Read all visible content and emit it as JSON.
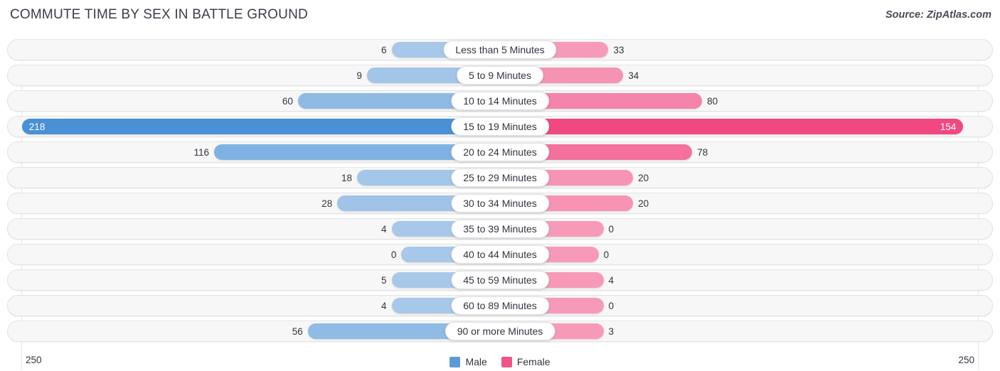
{
  "header": {
    "title": "COMMUTE TIME BY SEX IN BATTLE GROUND",
    "source": "Source: ZipAtlas.com"
  },
  "axis": {
    "left_label": "250",
    "right_label": "250"
  },
  "legend": {
    "items": [
      {
        "label": "Male",
        "color": "#5b9bd5"
      },
      {
        "label": "Female",
        "color": "#f0548b"
      }
    ]
  },
  "chart_data": {
    "type": "bar",
    "title": "COMMUTE TIME BY SEX IN BATTLE GROUND",
    "subtitle": "Source: ZipAtlas.com",
    "orientation": "horizontal-diverging",
    "xlabel": "",
    "ylabel": "",
    "xlim": [
      250,
      250
    ],
    "grid": false,
    "legend_position": "bottom-center",
    "categories": [
      "Less than 5 Minutes",
      "5 to 9 Minutes",
      "10 to 14 Minutes",
      "15 to 19 Minutes",
      "20 to 24 Minutes",
      "25 to 29 Minutes",
      "30 to 34 Minutes",
      "35 to 39 Minutes",
      "40 to 44 Minutes",
      "45 to 59 Minutes",
      "60 to 89 Minutes",
      "90 or more Minutes"
    ],
    "series": [
      {
        "name": "Male",
        "color": "#5b9bd5",
        "values": [
          6,
          9,
          60,
          218,
          116,
          18,
          28,
          4,
          0,
          5,
          4,
          56
        ]
      },
      {
        "name": "Female",
        "color": "#f0548b",
        "values": [
          33,
          34,
          80,
          154,
          78,
          20,
          20,
          0,
          0,
          4,
          0,
          3
        ]
      }
    ]
  },
  "rows": [
    {
      "label": "Less than 5 Minutes",
      "male": "6",
      "female": "33",
      "male_w": 22,
      "female_w": 22,
      "male_color": "#a8c8ea",
      "female_color": "#f79ab8",
      "male_inside": false,
      "female_inside": false
    },
    {
      "label": "5 to 9 Minutes",
      "male": "9",
      "female": "34",
      "male_w": 27,
      "female_w": 25,
      "male_color": "#a3c5e8",
      "female_color": "#f593b3",
      "male_inside": false,
      "female_inside": false
    },
    {
      "label": "10 to 14 Minutes",
      "male": "60",
      "female": "80",
      "male_w": 41,
      "female_w": 41,
      "male_color": "#8ebae4",
      "female_color": "#f583ab",
      "male_inside": false,
      "female_inside": false
    },
    {
      "label": "15 to 19 Minutes",
      "male": "218",
      "female": "154",
      "male_w": 97,
      "female_w": 94,
      "male_color": "#4a90d5",
      "female_color": "#f04880",
      "male_inside": true,
      "female_inside": true
    },
    {
      "label": "20 to 24 Minutes",
      "male": "116",
      "female": "78",
      "male_w": 58,
      "female_w": 39,
      "male_color": "#7fb2e2",
      "female_color": "#f4719e",
      "male_inside": false,
      "female_inside": false
    },
    {
      "label": "25 to 29 Minutes",
      "male": "18",
      "female": "20",
      "male_w": 29,
      "female_w": 27,
      "male_color": "#a4c6e9",
      "female_color": "#f794b4",
      "male_inside": false,
      "female_inside": false
    },
    {
      "label": "30 to 34 Minutes",
      "male": "28",
      "female": "20",
      "male_w": 33,
      "female_w": 27,
      "male_color": "#a0c3e7",
      "female_color": "#f794b4",
      "male_inside": false,
      "female_inside": false
    },
    {
      "label": "35 to 39 Minutes",
      "male": "4",
      "female": "0",
      "male_w": 22,
      "female_w": 21,
      "male_color": "#a8c8ea",
      "female_color": "#f79ab8",
      "male_inside": false,
      "female_inside": false
    },
    {
      "label": "40 to 44 Minutes",
      "male": "0",
      "female": "0",
      "male_w": 20,
      "female_w": 20,
      "male_color": "#a8c8ea",
      "female_color": "#f79ab8",
      "male_inside": false,
      "female_inside": false
    },
    {
      "label": "45 to 59 Minutes",
      "male": "5",
      "female": "4",
      "male_w": 22,
      "female_w": 21,
      "male_color": "#a8c8ea",
      "female_color": "#f79ab8",
      "male_inside": false,
      "female_inside": false
    },
    {
      "label": "60 to 89 Minutes",
      "male": "4",
      "female": "0",
      "male_w": 22,
      "female_w": 21,
      "male_color": "#a8c8ea",
      "female_color": "#f79ab8",
      "male_inside": false,
      "female_inside": false
    },
    {
      "label": "90 or more Minutes",
      "male": "56",
      "female": "3",
      "male_w": 39,
      "female_w": 21,
      "male_color": "#8fbbe5",
      "female_color": "#f79ab8",
      "male_inside": false,
      "female_inside": false
    }
  ]
}
